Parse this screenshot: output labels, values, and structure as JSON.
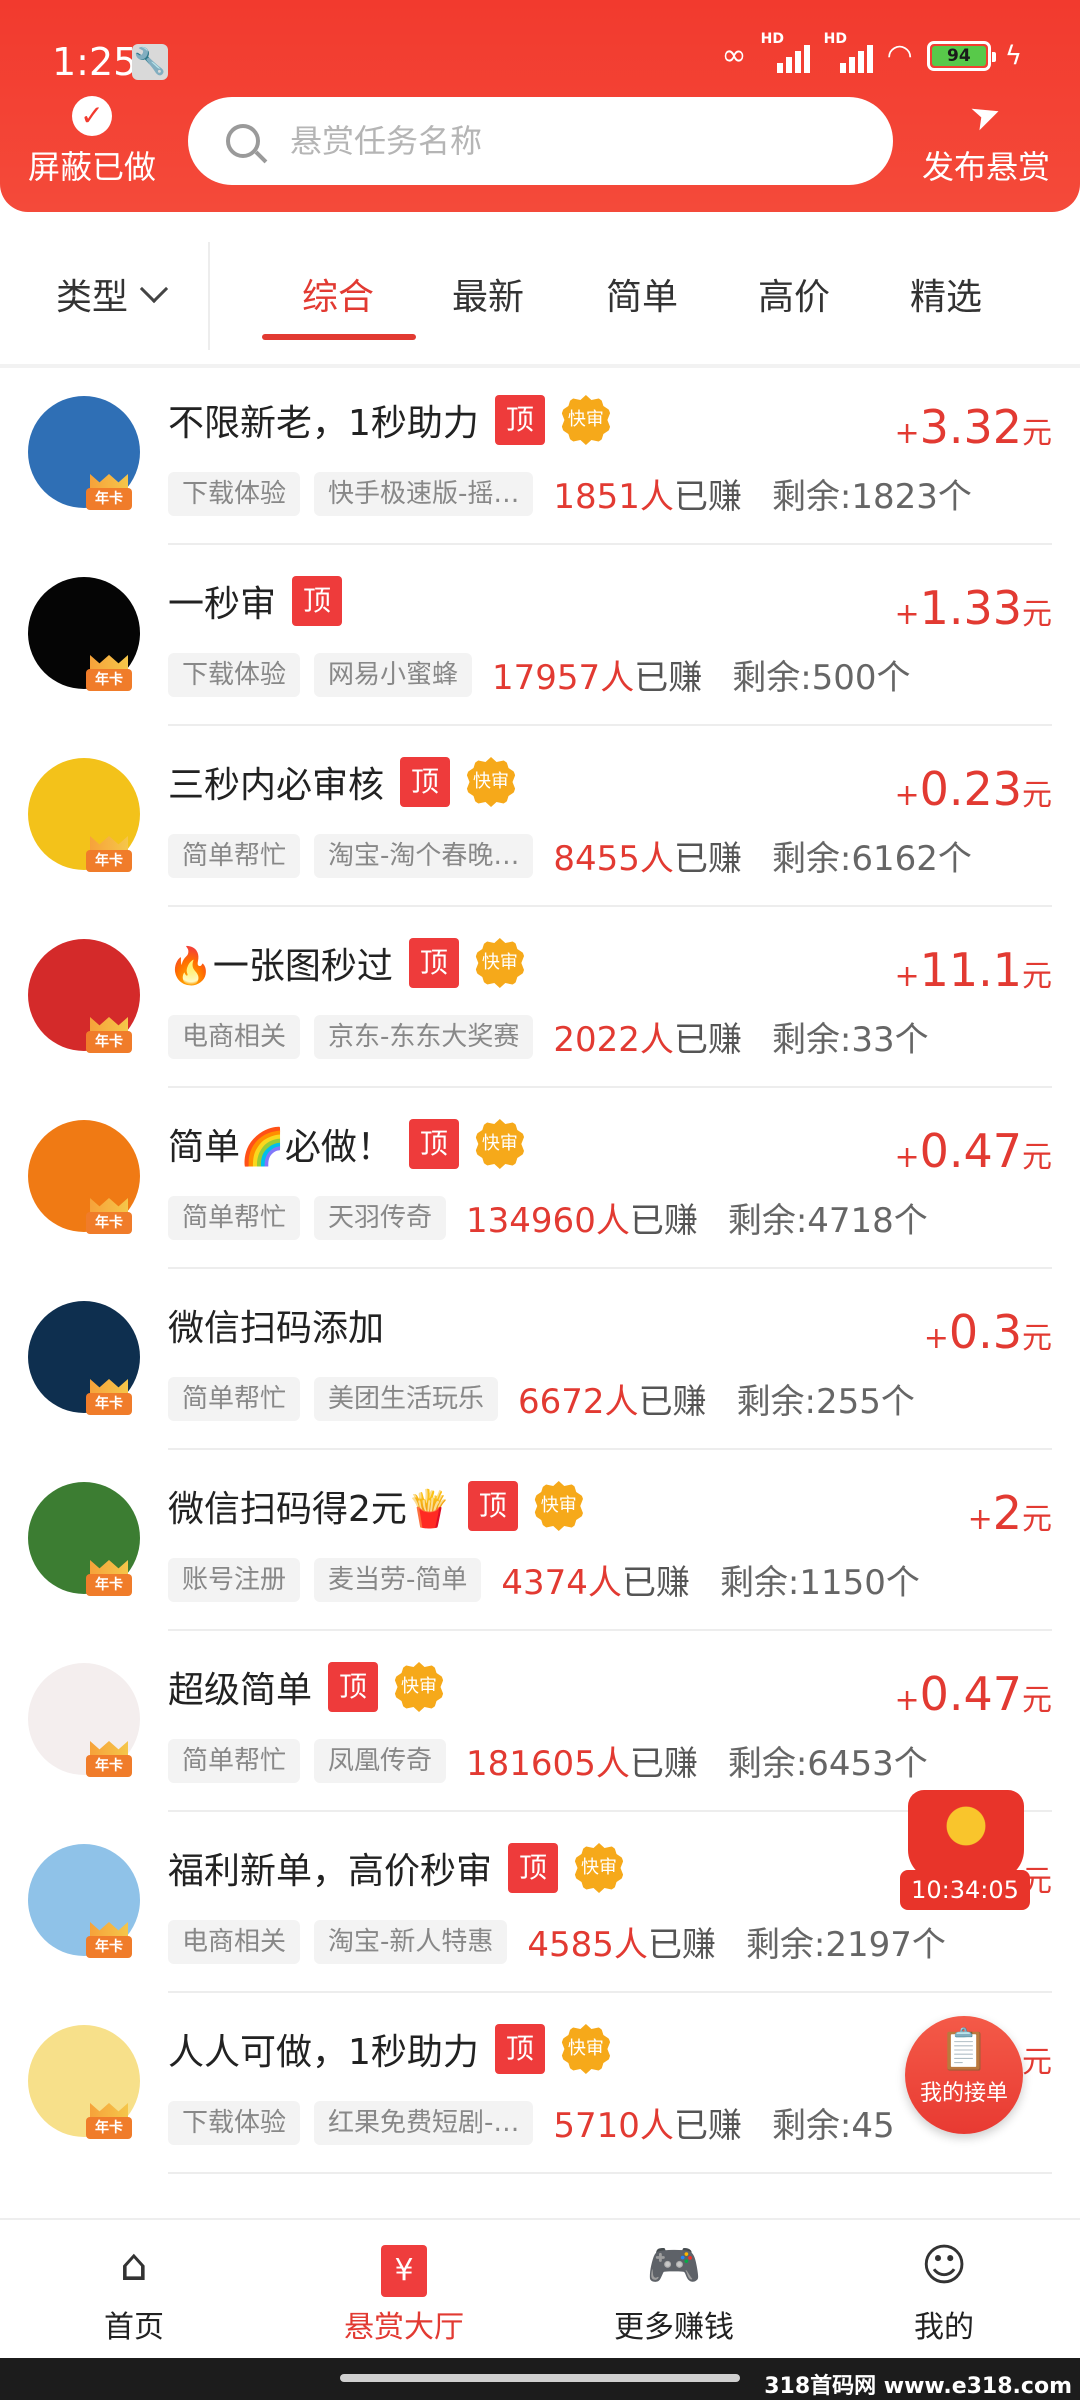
{
  "status_bar": {
    "time": "1:25",
    "battery": "94",
    "signal_label": "HD"
  },
  "header": {
    "hide_done_label": "屏蔽已做",
    "search_placeholder": "悬赏任务名称",
    "publish_label": "发布悬赏"
  },
  "filters": {
    "type_label": "类型",
    "tabs": [
      "综合",
      "最新",
      "简单",
      "高价",
      "精选"
    ],
    "active_tab": "综合"
  },
  "badges": {
    "top": "顶",
    "fast": "快审",
    "vip": "年卡"
  },
  "tasks": [
    {
      "title": "不限新老，1秒助力",
      "top": true,
      "fast": true,
      "category": "下载体验",
      "app": "快手极速版-摇…",
      "earned_count": "1851人",
      "earned_suffix": "已赚",
      "remaining": "剩余:1823个",
      "plus": "+",
      "reward": "3.32",
      "unit": "元",
      "avatar_color": "#2f6fb5"
    },
    {
      "title": "一秒审",
      "top": true,
      "fast": false,
      "category": "下载体验",
      "app": "网易小蜜蜂",
      "earned_count": "17957人",
      "earned_suffix": "已赚",
      "remaining": "剩余:500个",
      "plus": "+",
      "reward": "1.33",
      "unit": "元",
      "avatar_color": "#050505"
    },
    {
      "title": "三秒内必审核",
      "top": true,
      "fast": true,
      "category": "简单帮忙",
      "app": "淘宝-淘个春晚…",
      "earned_count": "8455人",
      "earned_suffix": "已赚",
      "remaining": "剩余:6162个",
      "plus": "+",
      "reward": "0.23",
      "unit": "元",
      "avatar_color": "#f3c21a"
    },
    {
      "title": "🔥一张图秒过",
      "top": true,
      "fast": true,
      "category": "电商相关",
      "app": "京东-东东大奖赛",
      "earned_count": "2022人",
      "earned_suffix": "已赚",
      "remaining": "剩余:33个",
      "plus": "+",
      "reward": "11.1",
      "unit": "元",
      "avatar_color": "#d42a2a"
    },
    {
      "title": "简单🌈必做！",
      "top": true,
      "fast": true,
      "category": "简单帮忙",
      "app": "天羽传奇",
      "earned_count": "134960人",
      "earned_suffix": "已赚",
      "remaining": "剩余:4718个",
      "plus": "+",
      "reward": "0.47",
      "unit": "元",
      "avatar_color": "#f07a14"
    },
    {
      "title": "微信扫码添加",
      "top": false,
      "fast": false,
      "category": "简单帮忙",
      "app": "美团生活玩乐",
      "earned_count": "6672人",
      "earned_suffix": "已赚",
      "remaining": "剩余:255个",
      "plus": "+",
      "reward": "0.3",
      "unit": "元",
      "avatar_color": "#0e2f4f"
    },
    {
      "title": "微信扫码得2元🍟",
      "top": true,
      "fast": true,
      "category": "账号注册",
      "app": "麦当劳-简单",
      "earned_count": "4374人",
      "earned_suffix": "已赚",
      "remaining": "剩余:1150个",
      "plus": "+",
      "reward": "2",
      "unit": "元",
      "avatar_color": "#3c7d32"
    },
    {
      "title": "超级简单",
      "top": true,
      "fast": true,
      "category": "简单帮忙",
      "app": "凤凰传奇",
      "earned_count": "181605人",
      "earned_suffix": "已赚",
      "remaining": "剩余:6453个",
      "plus": "+",
      "reward": "0.47",
      "unit": "元",
      "avatar_color": "#f4eeee"
    },
    {
      "title": "福利新单，高价秒审",
      "top": true,
      "fast": true,
      "category": "电商相关",
      "app": "淘宝-新人特惠",
      "earned_count": "4585人",
      "earned_suffix": "已赚",
      "remaining": "剩余:2197个",
      "plus": "",
      "reward": "",
      "unit": "元",
      "avatar_color": "#8fc2e8"
    },
    {
      "title": "人人可做，1秒助力",
      "top": true,
      "fast": true,
      "category": "下载体验",
      "app": "红果免费短剧-…",
      "earned_count": "5710人",
      "earned_suffix": "已赚",
      "remaining": "剩余:45",
      "plus": "",
      "reward": "",
      "unit": "元",
      "avatar_color": "#f7e08a"
    }
  ],
  "float_widgets": {
    "timer": "10:34:05",
    "my_orders_label": "我的接单"
  },
  "bottom_nav": [
    {
      "label": "首页",
      "icon": "home-icon"
    },
    {
      "label": "悬赏大厅",
      "icon": "yuan-icon"
    },
    {
      "label": "更多赚钱",
      "icon": "gamepad-icon"
    },
    {
      "label": "我的",
      "icon": "user-icon"
    }
  ],
  "watermark": "318首码网 www.e318.com",
  "colors": {
    "brand_red": "#f23a2e",
    "price_red": "#e23a32"
  }
}
